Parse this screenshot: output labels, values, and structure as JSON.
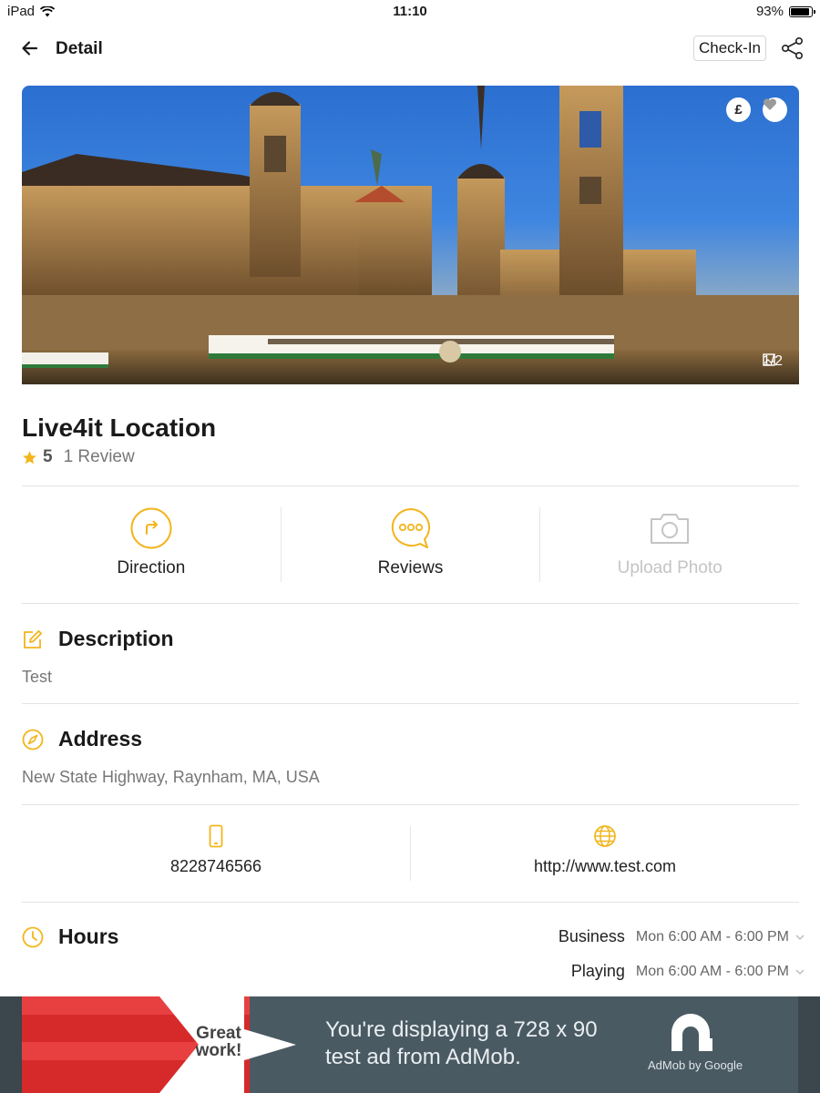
{
  "status_bar": {
    "device": "iPad",
    "time": "11:10",
    "battery": "93%",
    "battery_level": 0.93
  },
  "nav": {
    "title": "Detail",
    "checkin_label": "Check-In"
  },
  "hero": {
    "price_badge": "£",
    "photo_counter": "1/2"
  },
  "place": {
    "name": "Live4it Location",
    "rating": "5",
    "review_count": "1 Review"
  },
  "actions": {
    "direction": "Direction",
    "reviews": "Reviews",
    "upload_photo": "Upload Photo"
  },
  "description": {
    "heading": "Description",
    "text": "Test"
  },
  "address": {
    "heading": "Address",
    "text": "New State Highway, Raynham, MA, USA"
  },
  "contact": {
    "phone": "8228746566",
    "website": "http://www.test.com"
  },
  "hours": {
    "heading": "Hours",
    "rows": [
      {
        "kind": "Business",
        "time": "Mon 6:00 AM - 6:00 PM"
      },
      {
        "kind": "Playing",
        "time": "Mon 6:00 AM - 6:00 PM"
      }
    ]
  },
  "ad": {
    "badge_line1": "Great",
    "badge_line2": "work!",
    "message": "You're displaying a 728 x 90 test ad from AdMob.",
    "brand": "AdMob by Google"
  },
  "colors": {
    "accent": "#f2b51c",
    "disabled": "#c4c4c4",
    "ad_background": "#4a5a63",
    "ad_red": "#d62a2a"
  }
}
